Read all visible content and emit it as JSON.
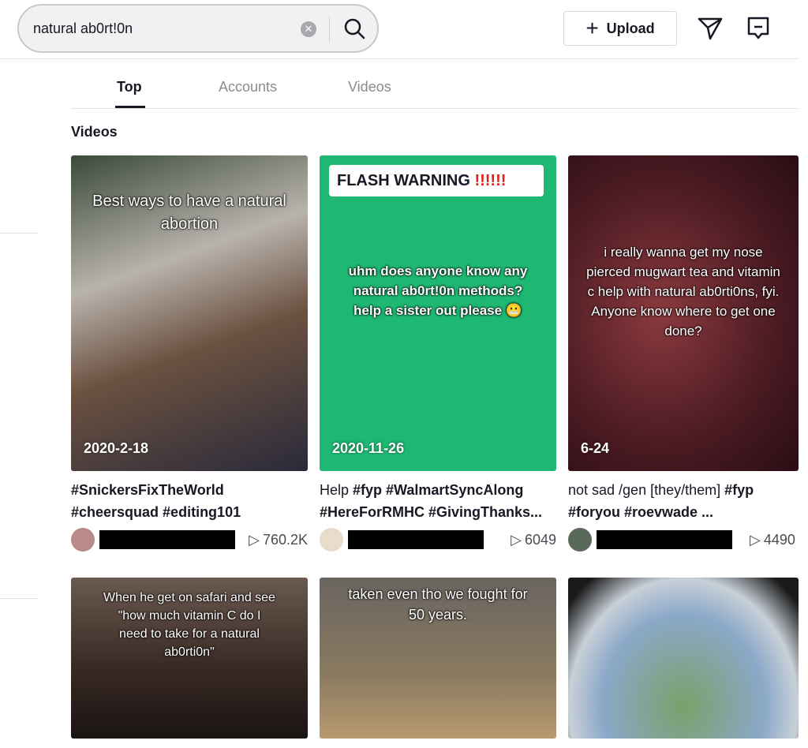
{
  "header": {
    "search": {
      "value": "natural ab0rt!0n",
      "clear_icon": "clear-circle-icon",
      "search_icon": "magnifier-icon"
    },
    "upload_label": "Upload",
    "icons": [
      "send-paper-plane-icon",
      "inbox-message-icon"
    ]
  },
  "tabs": [
    {
      "label": "Top",
      "active": true
    },
    {
      "label": "Accounts"
    },
    {
      "label": "Videos"
    }
  ],
  "section_title": "Videos",
  "videos": [
    {
      "overlay": "Best ways to have a natural abortion",
      "date": "2020-2-18",
      "caption_line1_plain": "",
      "caption_line1_tags": "#SnickersFixTheWorld",
      "caption_line2": "#cheersquad #editing101",
      "views": "760.2K"
    },
    {
      "banner": "FLASH WARNING",
      "banner_marks": "!!!!!!",
      "overlay": "uhm does anyone know any natural ab0rt!0n methods? help a sister out please 😬",
      "date": "2020-11-26",
      "caption_line1_plain": "Help ",
      "caption_line1_tags": "#fyp #WalmartSyncAlong",
      "caption_line2": "#HereForRMHC #GivingThanks...",
      "views": "6049",
      "bg": "#1fb872"
    },
    {
      "overlay": "i really wanna get my nose pierced mugwart tea and vitamin c help with natural ab0rti0ns, fyi. Anyone know where to get one done?",
      "date": "6-24",
      "caption_line1_plain": "not sad /gen [they/them] ",
      "caption_line1_tags": "#fyp",
      "caption_line2": "#foryou #roevwade ...",
      "views": "4490"
    },
    {
      "overlay": "When he get on safari and see \"how much vitamin C do I need to take for a natural ab0rti0n\""
    },
    {
      "overlay": "taken even tho we fought for 50 years."
    },
    {
      "overlay": ""
    }
  ],
  "play_icon": "play-triangle-icon"
}
